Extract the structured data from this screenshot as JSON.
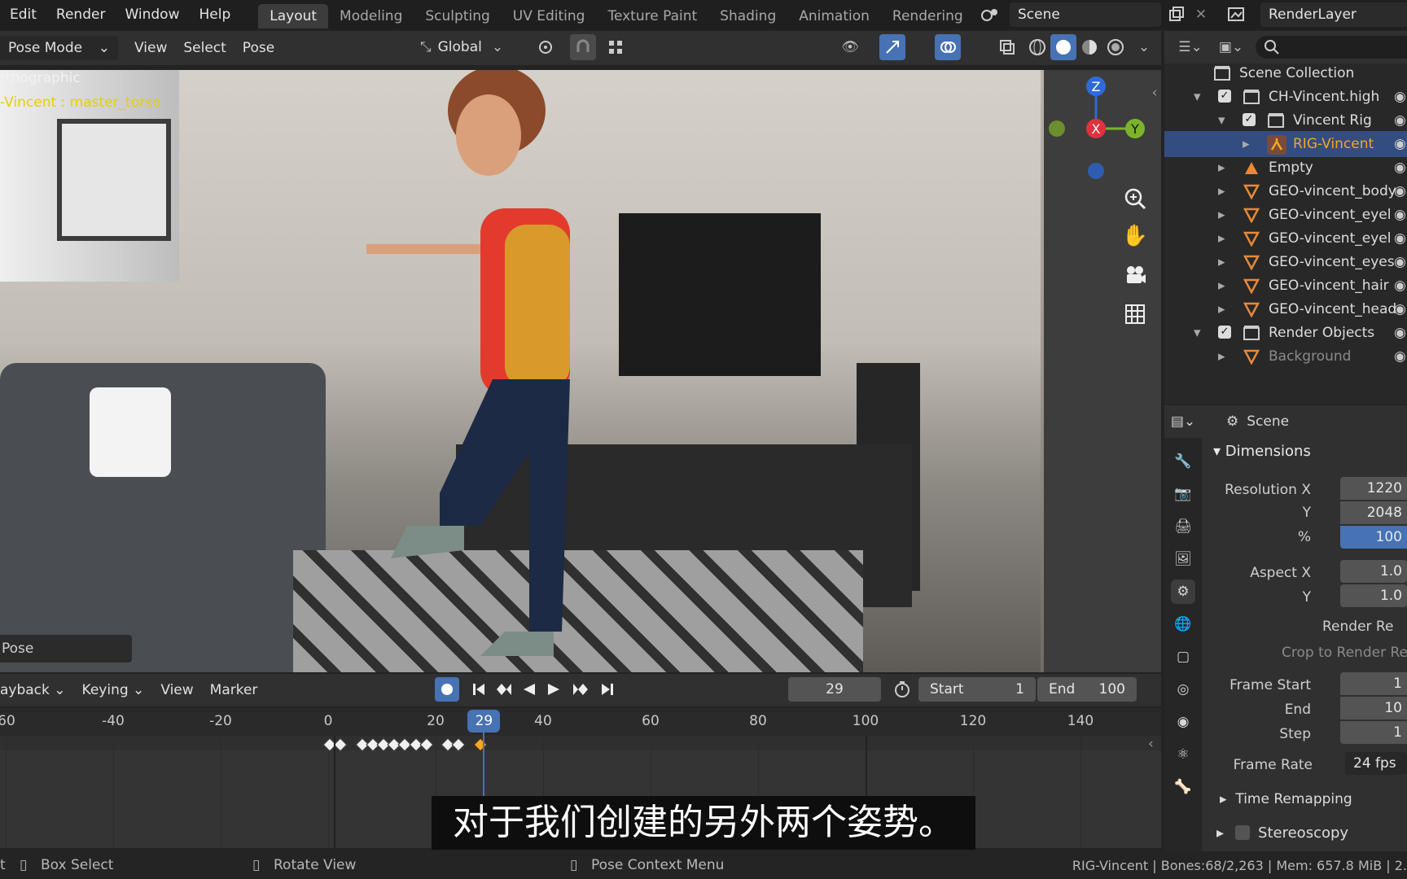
{
  "topbar": {
    "menus": [
      "Edit",
      "Render",
      "Window",
      "Help"
    ],
    "workspaces": [
      "Layout",
      "Modeling",
      "Sculpting",
      "UV Editing",
      "Texture Paint",
      "Shading",
      "Animation",
      "Rendering"
    ],
    "active_workspace": "Layout",
    "scene": "Scene",
    "view_layer": "RenderLayer"
  },
  "viewport_header": {
    "mode": "Pose Mode",
    "menus": [
      "View",
      "Select",
      "Pose"
    ],
    "transform_orientation": "Global"
  },
  "viewport": {
    "view_name": "rthographic",
    "active_object": "-Vincent : master_torso",
    "last_operator": "Pose",
    "gizmo": {
      "z": "Z",
      "x": "X",
      "y": "Y"
    }
  },
  "timeline_header": {
    "menus": [
      "ayback",
      "Keying",
      "View",
      "Marker"
    ],
    "current_frame": "29",
    "start_label": "Start",
    "start": "1",
    "end_label": "End",
    "end": "100"
  },
  "timeline": {
    "ticks": [
      "60",
      "-40",
      "-20",
      "0",
      "20",
      "40",
      "60",
      "80",
      "100",
      "120",
      "140"
    ],
    "current_frame": 29,
    "keyframes": [
      0,
      2,
      6,
      8,
      10,
      12,
      14,
      16,
      18,
      22,
      24,
      28
    ]
  },
  "outliner": {
    "rows": [
      {
        "label": "Scene Collection"
      },
      {
        "label": "CH-Vincent.high"
      },
      {
        "label": "Vincent Rig"
      },
      {
        "label": "RIG-Vincent"
      },
      {
        "label": "Empty"
      },
      {
        "label": "GEO-vincent_body"
      },
      {
        "label": "GEO-vincent_eyel"
      },
      {
        "label": "GEO-vincent_eyel"
      },
      {
        "label": "GEO-vincent_eyes"
      },
      {
        "label": "GEO-vincent_hair"
      },
      {
        "label": "GEO-vincent_head"
      },
      {
        "label": "Render Objects"
      },
      {
        "label": "Background"
      }
    ]
  },
  "properties": {
    "context": "Scene",
    "panel": "Dimensions",
    "resolution_x_label": "Resolution X",
    "resolution_x": "1220",
    "y_label": "Y",
    "resolution_y": "2048",
    "percent_label": "%",
    "percent": "100",
    "aspect_x_label": "Aspect X",
    "aspect_x": "1.0",
    "aspect_y_label": "Y",
    "aspect_y": "1.0",
    "render_region": "Render Re",
    "crop": "Crop to Render Re",
    "frame_start_label": "Frame Start",
    "frame_start": "1",
    "end_label": "End",
    "frame_end": "10",
    "step_label": "Step",
    "step": "1",
    "frame_rate_label": "Frame Rate",
    "frame_rate": "24 fps",
    "time_remapping": "Time Remapping",
    "stereoscopy": "Stereoscopy"
  },
  "status": {
    "left": "t",
    "box_select": "Box Select",
    "rotate_view": "Rotate View",
    "context_menu": "Pose Context Menu",
    "info": "RIG-Vincent | Bones:68/2,263  |  Mem: 657.8 MiB | 2."
  },
  "subtitle": "对于我们创建的另外两个姿势。",
  "colors": {
    "accent": "#4772b3",
    "active_obj": "#f5a623",
    "selected_row": "#334d80"
  }
}
